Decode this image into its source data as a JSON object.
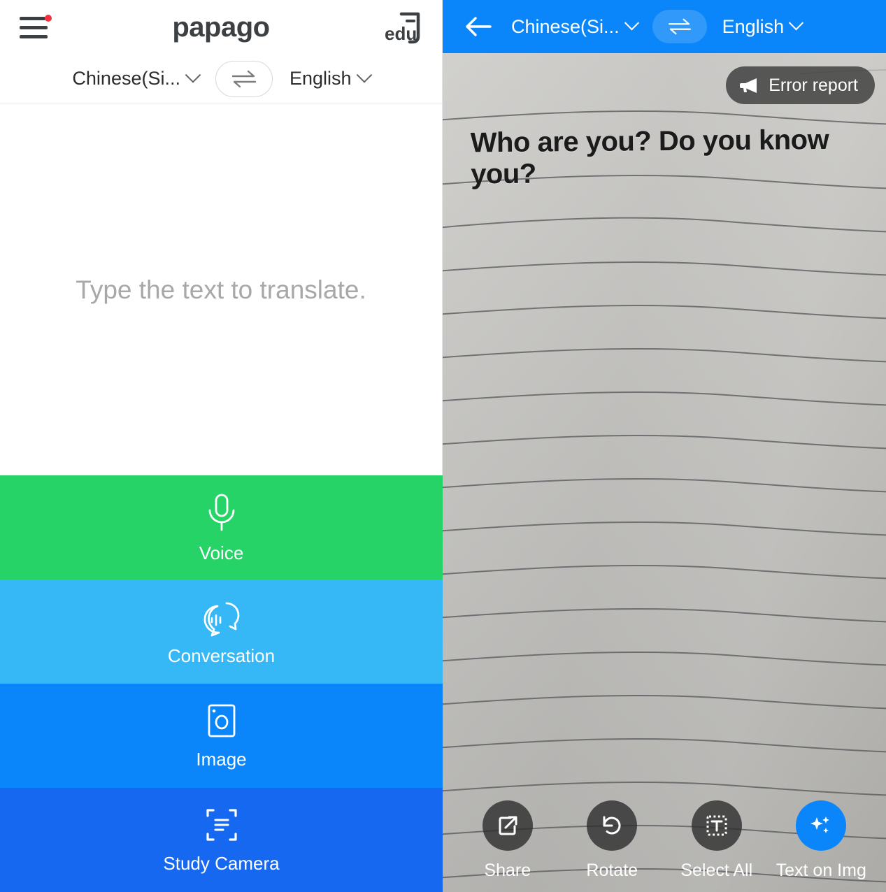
{
  "app": {
    "brand": "papago",
    "edu_badge": "edu"
  },
  "left": {
    "menu_icon": "hamburger-menu-icon",
    "menu_has_badge": true,
    "source_language": "Chinese(Si...",
    "target_language": "English",
    "swap_icon": "swap-arrows-icon",
    "compose_placeholder": "Type the text to translate.",
    "tiles": [
      {
        "label": "Voice",
        "icon": "microphone-icon",
        "color": "#25d366"
      },
      {
        "label": "Conversation",
        "icon": "conversation-bubbles-icon",
        "color": "#35b8f5"
      },
      {
        "label": "Image",
        "icon": "photo-camera-icon",
        "color": "#0a86fa"
      },
      {
        "label": "Study Camera",
        "icon": "document-scan-icon",
        "color": "#1668f0"
      }
    ]
  },
  "right": {
    "header_color": "#0a86fa",
    "back_icon": "back-arrow-icon",
    "source_language": "Chinese(Si...",
    "target_language": "English",
    "swap_icon": "swap-arrows-icon",
    "error_report": {
      "label": "Error report",
      "icon": "megaphone-icon"
    },
    "ocr_overlay_text": "Who are you? Do you know you?",
    "toolbar": [
      {
        "label": "Share",
        "icon": "share-export-icon",
        "accent": false
      },
      {
        "label": "Rotate",
        "icon": "rotate-counterclockwise-icon",
        "accent": false
      },
      {
        "label": "Select All",
        "icon": "select-all-text-icon",
        "accent": false
      },
      {
        "label": "Text on Img",
        "icon": "sparkles-icon",
        "accent": true
      }
    ]
  }
}
